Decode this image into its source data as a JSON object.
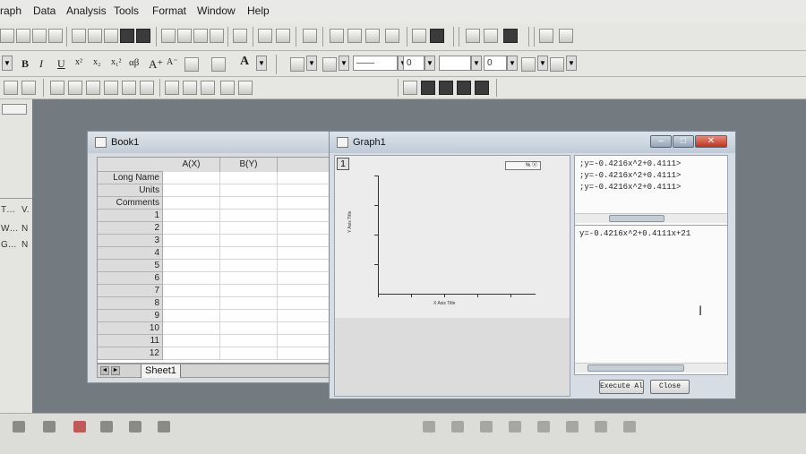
{
  "menu": [
    "raph",
    "Data",
    "Analysis",
    "Tools",
    "Format",
    "Window",
    "Help"
  ],
  "format_toolbar": {
    "bold": "B",
    "italic": "I",
    "underline": "U",
    "superscript": "x²",
    "subscript": "x₂",
    "supsub": "x₁²",
    "greek": "αβ",
    "increase_font": "A⁺",
    "decrease_font": "A⁻",
    "line_width_value": "0",
    "pattern_value": "0"
  },
  "left_panel": {
    "rows": [
      {
        "name": "T…",
        "value": "V."
      },
      {
        "name": "W…",
        "value": "N"
      },
      {
        "name": "G…",
        "value": "N"
      }
    ]
  },
  "book": {
    "title": "Book1",
    "columns": [
      "A(X)",
      "B(Y)"
    ],
    "row_labels": [
      "Long Name",
      "Units",
      "Comments",
      "1",
      "2",
      "3",
      "4",
      "5",
      "6",
      "7",
      "8",
      "9",
      "10",
      "11",
      "12"
    ],
    "sheet_tab": "Sheet1"
  },
  "graph": {
    "title": "Graph1",
    "layer_label": "1",
    "legend_text": "% ⓧ",
    "x_axis_title": "X Axis Title",
    "y_axis_title": "Y Axis Title",
    "script_lines": [
      ";y=-0.4216x^2+0.4111>",
      ";y=-0.4216x^2+0.4111>",
      ";y=-0.4216x^2+0.4111>"
    ],
    "command": "y=-0.4216x^2+0.4111x+21",
    "execute_label": "Execute Al",
    "close_label": "Close",
    "min_icon": "–",
    "max_icon": "□",
    "close_icon": "✕"
  },
  "colors": {
    "workspace": "#737a80",
    "close_button": "#c2301b",
    "title_bar": "#c3ccd6"
  }
}
